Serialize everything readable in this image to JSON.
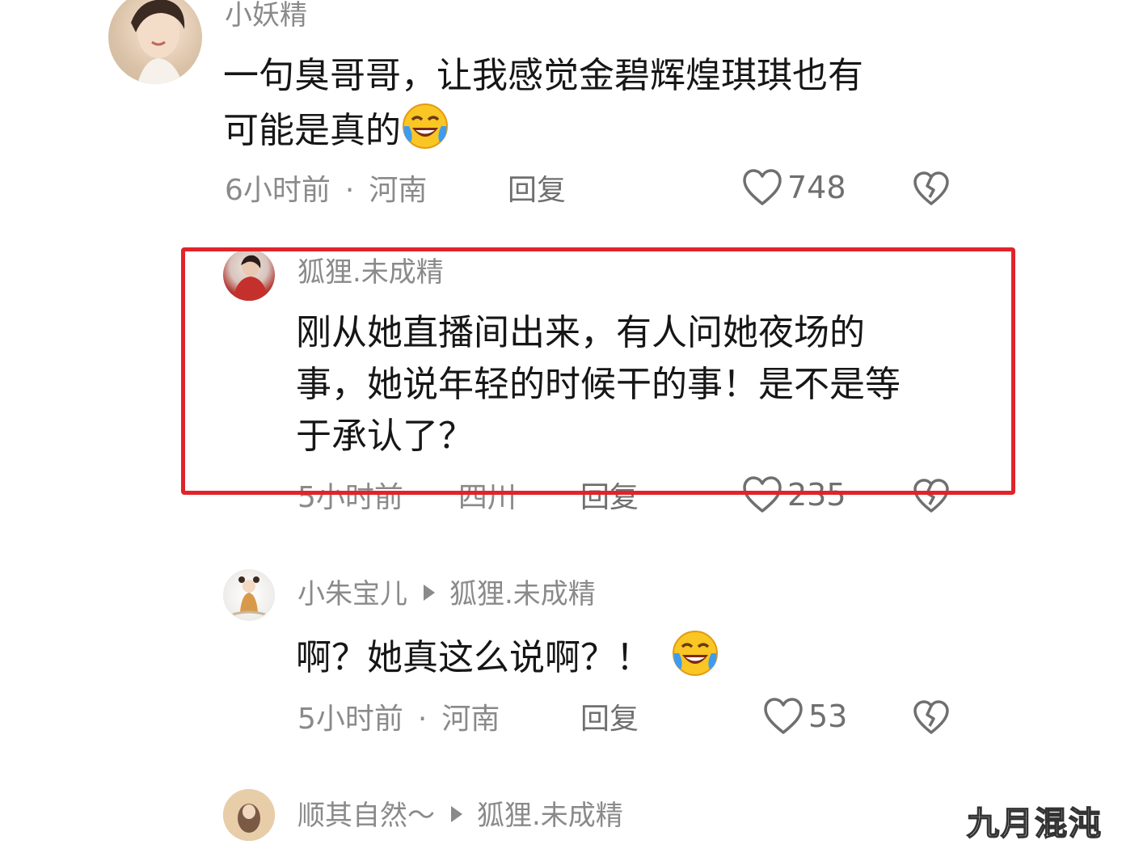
{
  "comments": [
    {
      "username": "小妖精",
      "content_line1": "一句臭哥哥，让我感觉金碧辉煌琪琪也有",
      "content_line2": "可能是真的",
      "emoji": "laughing-crying-emoji",
      "time": "6小时前",
      "dot": "·",
      "location": "河南",
      "reply_label": "回复",
      "likes": "748"
    },
    {
      "username": "狐狸.未成精",
      "content_line1": "刚从她直播间出来，有人问她夜场的",
      "content_line2": "事，她说年轻的时候干的事！是不是等",
      "content_line3": "于承认了？",
      "time": "5小时前",
      "location": "四川",
      "reply_label": "回复",
      "likes": "235"
    },
    {
      "username": "小朱宝儿",
      "reply_to": "狐狸.未成精",
      "content": "啊？她真这么说啊？！",
      "emoji": "laughing-crying-emoji",
      "time": "5小时前",
      "dot": "·",
      "location": "河南",
      "reply_label": "回复",
      "likes": "53"
    },
    {
      "username": "顺其自然～",
      "reply_to": "狐狸.未成精"
    }
  ],
  "watermark": "九月混沌",
  "colors": {
    "highlight": "#e0242a",
    "meta_text": "#8a8a8a",
    "content_text": "#161616"
  },
  "icons": {
    "like": "heart-outline-icon",
    "dislike": "broken-heart-icon",
    "reply_arrow": "triangle-right-icon"
  }
}
